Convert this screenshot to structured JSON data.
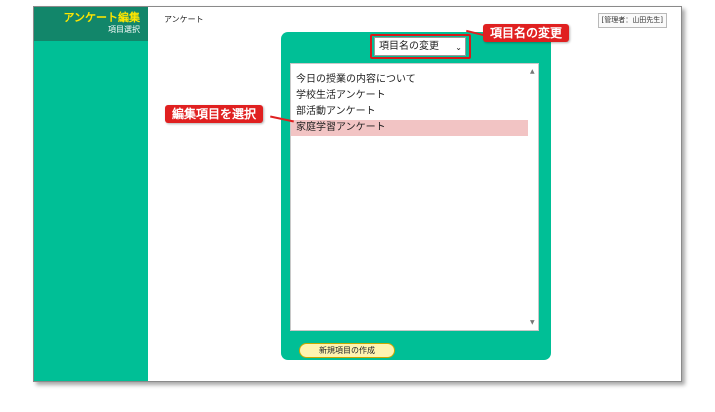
{
  "sidebar": {
    "title": "アンケート編集",
    "subtitle": "項目選択",
    "colors": {
      "background": "#00bf96",
      "header": "#12866a",
      "title": "#ffe600"
    }
  },
  "header": {
    "page_title": "アンケート",
    "admin_badge": "[管理者：山田先生]"
  },
  "panel": {
    "select": {
      "value": "項目名の変更",
      "icon": "chevron-down-icon"
    },
    "items": [
      {
        "label": "今日の授業の内容について",
        "selected": false
      },
      {
        "label": "学校生活アンケート",
        "selected": false
      },
      {
        "label": "部活動アンケート",
        "selected": false
      },
      {
        "label": "家庭学習アンケート",
        "selected": true
      }
    ],
    "create_button": "新規項目の作成"
  },
  "callouts": {
    "rename": "項目名の変更",
    "select_item": "編集項目を選択",
    "color": "#e02020"
  }
}
